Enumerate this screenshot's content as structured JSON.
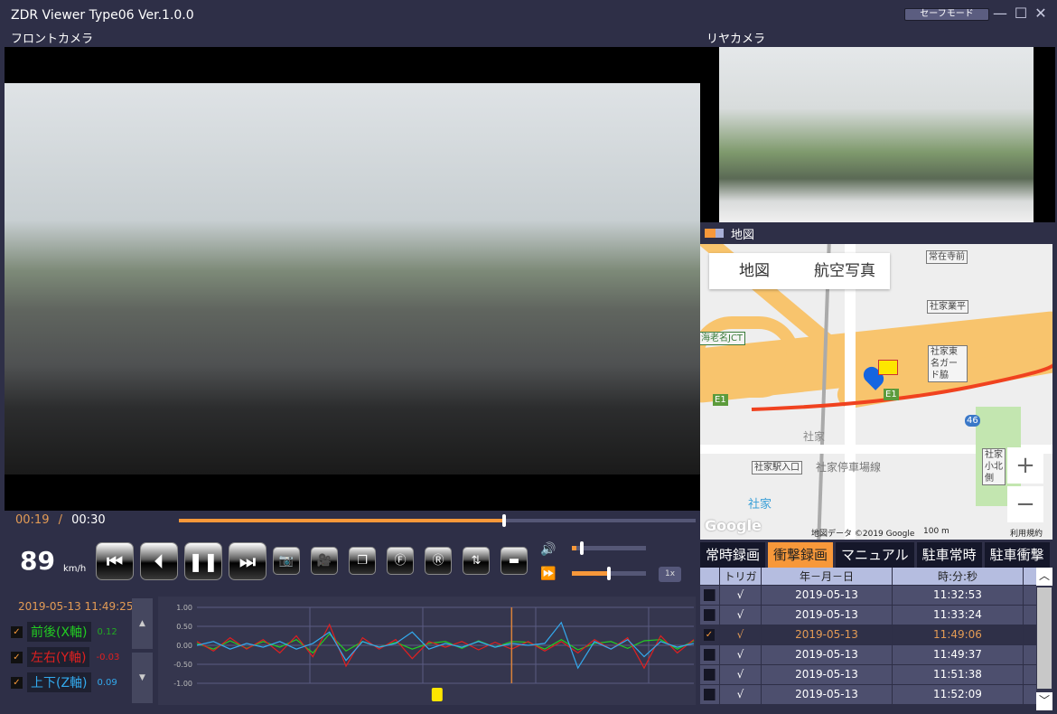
{
  "app": {
    "title": "ZDR Viewer Type06 Ver.1.0.0",
    "safe_mode": "セーフモード",
    "minimize": "—",
    "maximize": "☐",
    "close": "✕"
  },
  "front_label": "フロントカメラ",
  "rear_label": "リヤカメラ",
  "map": {
    "header": "地図",
    "tab_map": "地図",
    "tab_aerial": "航空写真",
    "labels": [
      "常在寺前",
      "社家業平",
      "社家東名ガード脇",
      "海老名JCT",
      "E1",
      "E1",
      "46",
      "社家",
      "社家駅入口",
      "社家停車場線",
      "社家小北側",
      "社家"
    ],
    "zoom_in": "+",
    "zoom_out": "−",
    "google": "Google",
    "credit": "地図データ ©2019 Google",
    "scale": "100 m",
    "terms": "利用規約"
  },
  "playback": {
    "current": "00:19",
    "separator": "/",
    "total": "00:30",
    "progress": 0.63,
    "speed": "89",
    "speed_unit": "km/h",
    "volume": 0.06,
    "play_rate": 0.5,
    "rate_label": "1x"
  },
  "icons": [
    "skip-start-icon",
    "step-back-icon",
    "pause-icon",
    "skip-end-icon",
    "camera-icon",
    "video-camera-icon",
    "copy-windows-icon",
    "front-rotate-icon",
    "rear-rotate-icon",
    "flip-icon",
    "folder-icon"
  ],
  "gsensor": {
    "datetime": "2019-05-13 11:49:25",
    "axes": [
      {
        "label": "前後(X軸)",
        "value": "0.12",
        "color": "#22cc22"
      },
      {
        "label": "左右(Y軸)",
        "value": "-0.03",
        "color": "#e02020"
      },
      {
        "label": "上下(Z軸)",
        "value": "0.09",
        "color": "#33aaee"
      }
    ]
  },
  "chart_data": {
    "type": "line",
    "ylim": [
      -1,
      1
    ],
    "yticks": [
      "1.00",
      "0.50",
      "0.00",
      "-0.50",
      "-1.00"
    ],
    "xlim": [
      0,
      30
    ],
    "cursor_time": 19,
    "event_marker_time": 14.5,
    "grid": true,
    "series": [
      {
        "name": "前後(X軸)",
        "color": "#22cc22",
        "values": [
          0.05,
          -0.1,
          0.12,
          -0.08,
          0.1,
          -0.05,
          0.15,
          -0.2,
          0.3,
          -0.15,
          0.1,
          -0.05,
          0.08,
          -0.1,
          0.05,
          0.1,
          -0.08,
          0.12,
          -0.05,
          0.1,
          0.08,
          -0.1,
          0.15,
          -0.12,
          0.05,
          0.1,
          -0.08,
          0.12,
          0.15,
          -0.1,
          0.12
        ]
      },
      {
        "name": "左右(Y軸)",
        "color": "#e02020",
        "values": [
          0.1,
          -0.15,
          0.2,
          -0.1,
          0.15,
          -0.2,
          0.25,
          -0.3,
          0.55,
          -0.55,
          0.2,
          -0.1,
          0.15,
          -0.35,
          0.1,
          -0.05,
          0.1,
          -0.12,
          0.08,
          -0.1,
          0.1,
          -0.15,
          0.1,
          -0.2,
          0.15,
          -0.1,
          0.2,
          -0.6,
          0.25,
          -0.2,
          0.15
        ]
      },
      {
        "name": "上下(Z軸)",
        "color": "#33aaee",
        "values": [
          0.0,
          0.1,
          -0.1,
          0.05,
          -0.05,
          0.1,
          -0.1,
          0.05,
          0.35,
          -0.4,
          0.1,
          -0.05,
          0.05,
          0.35,
          -0.1,
          0.05,
          -0.05,
          0.1,
          -0.05,
          0.05,
          0.0,
          0.05,
          0.6,
          -0.6,
          0.1,
          -0.1,
          0.15,
          -0.3,
          0.1,
          -0.05,
          0.05
        ]
      }
    ]
  },
  "record_tabs": [
    "常時録画",
    "衝撃録画",
    "マニュアル",
    "駐車常時",
    "駐車衝撃"
  ],
  "active_tab": 1,
  "table": {
    "headers": [
      "",
      "トリガ",
      "年－月－日",
      "時:分:秒"
    ],
    "rows": [
      {
        "checked": false,
        "trigger": "√",
        "date": "2019-05-13",
        "time": "11:32:53"
      },
      {
        "checked": false,
        "trigger": "√",
        "date": "2019-05-13",
        "time": "11:33:24"
      },
      {
        "checked": true,
        "trigger": "√",
        "date": "2019-05-13",
        "time": "11:49:06"
      },
      {
        "checked": false,
        "trigger": "√",
        "date": "2019-05-13",
        "time": "11:49:37"
      },
      {
        "checked": false,
        "trigger": "√",
        "date": "2019-05-13",
        "time": "11:51:38"
      },
      {
        "checked": false,
        "trigger": "√",
        "date": "2019-05-13",
        "time": "11:52:09"
      }
    ]
  }
}
